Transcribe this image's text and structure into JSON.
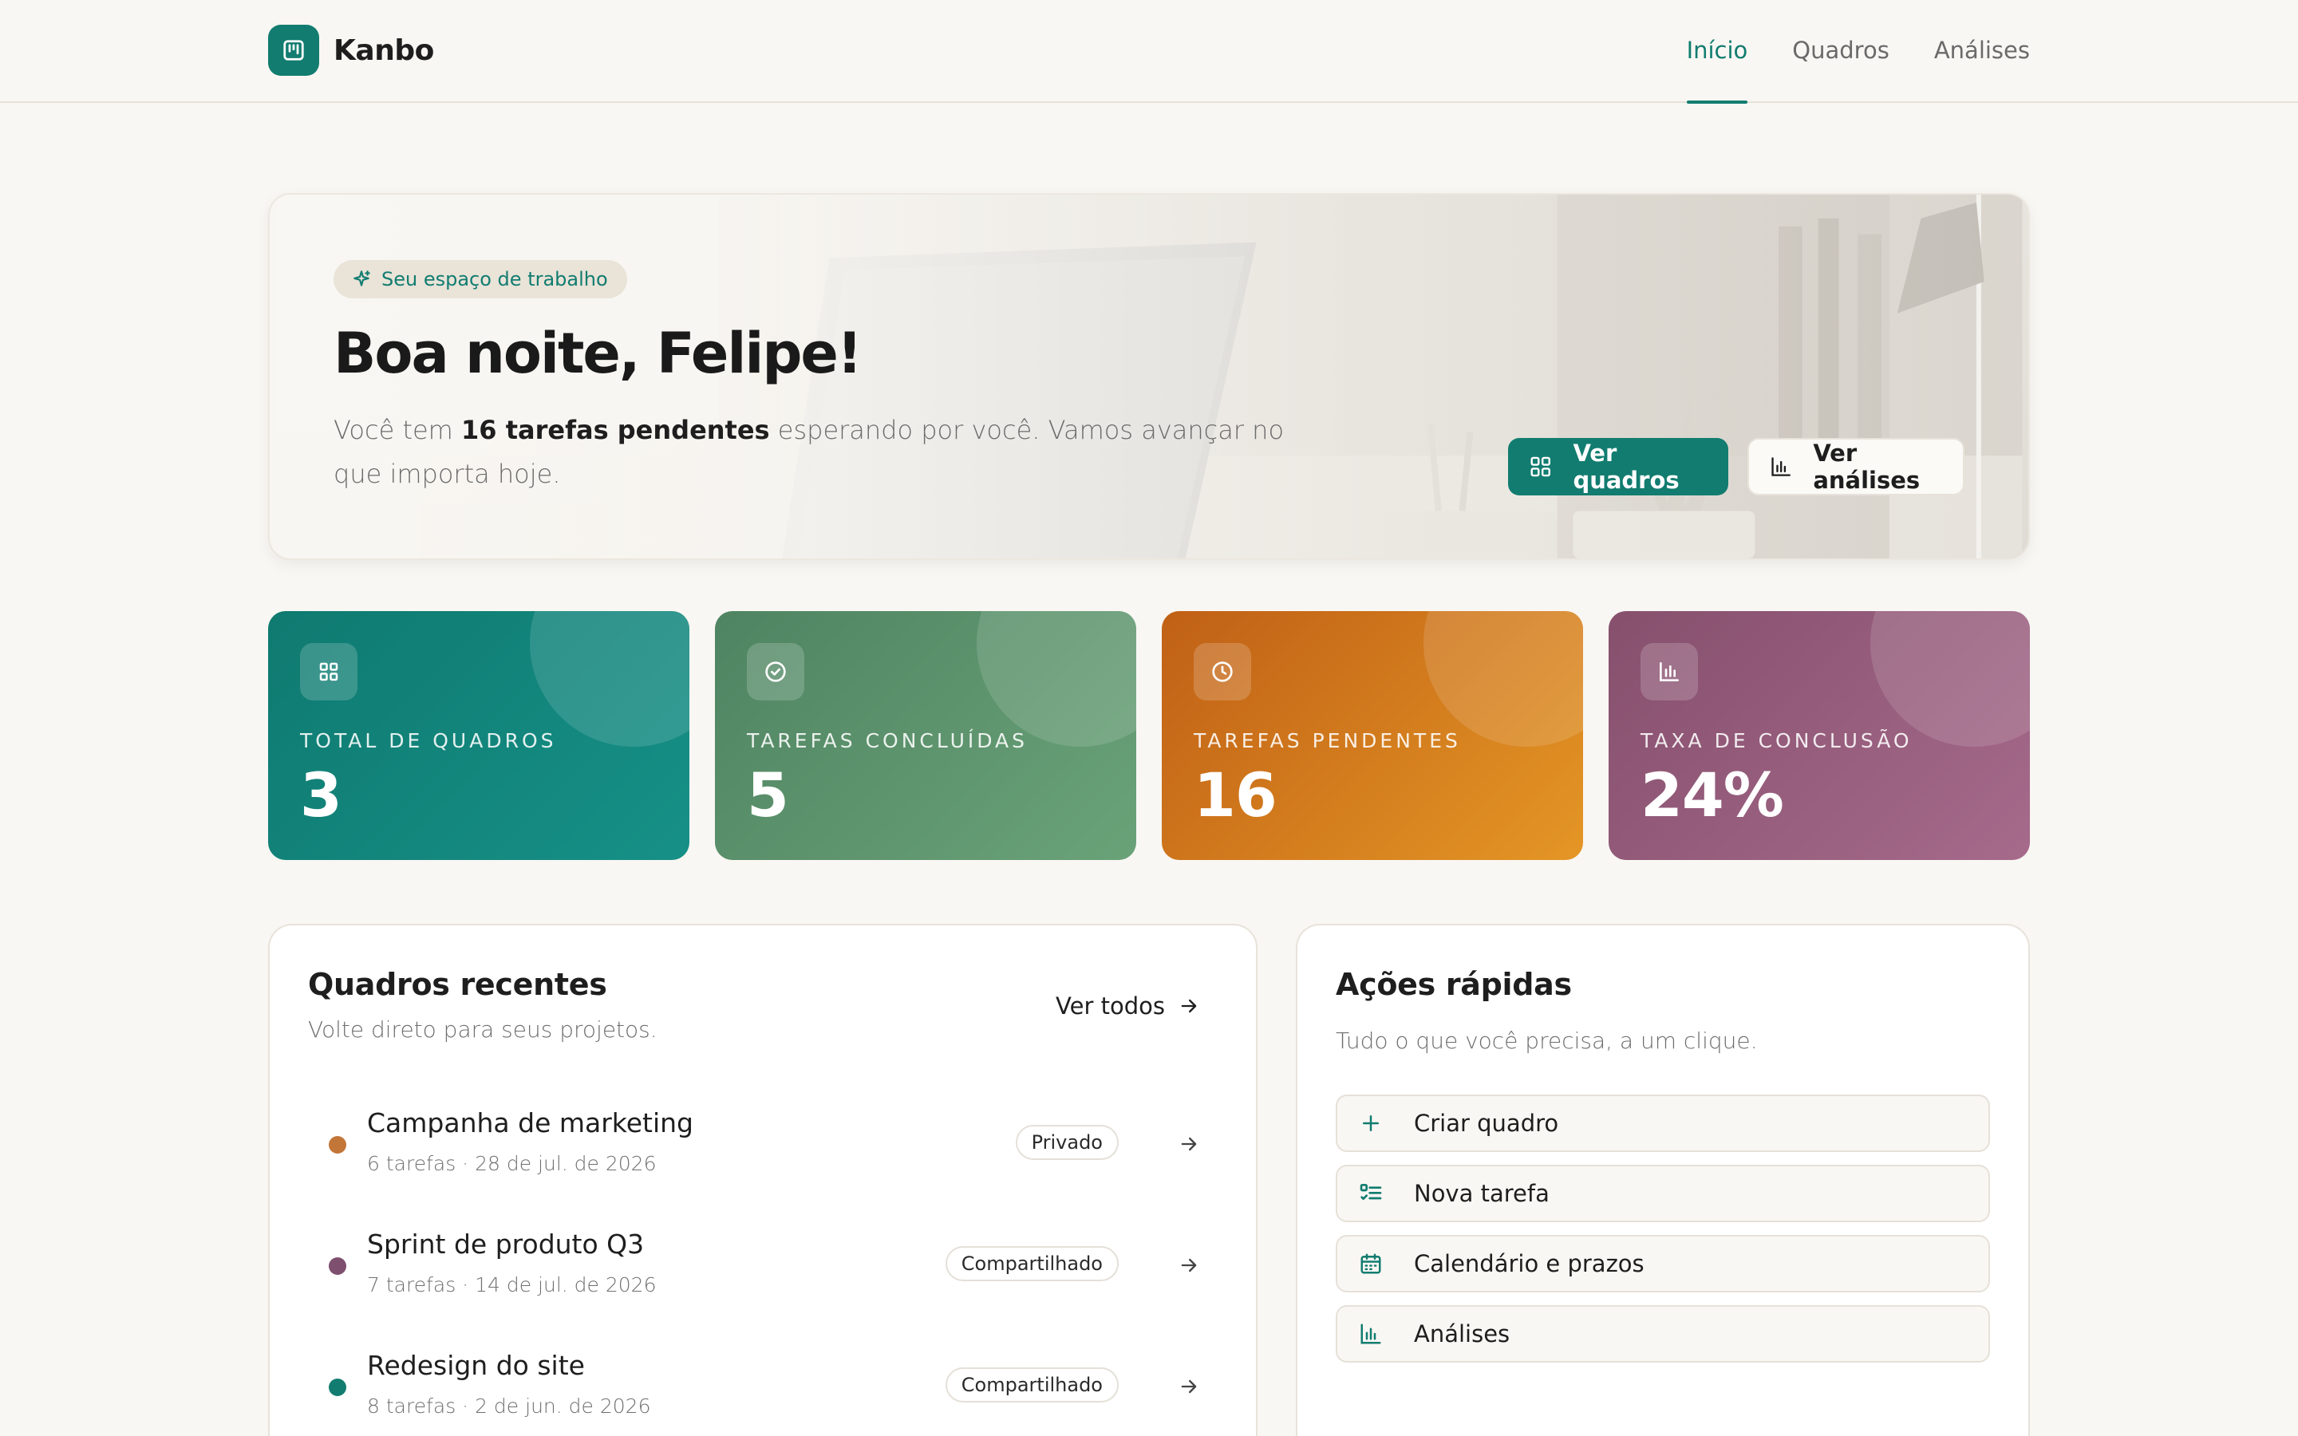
{
  "app": {
    "name": "Kanbo"
  },
  "nav": [
    {
      "label": "Início",
      "active": true
    },
    {
      "label": "Quadros",
      "active": false
    },
    {
      "label": "Análises",
      "active": false
    }
  ],
  "hero": {
    "badge": "Seu espaço de trabalho",
    "title": "Boa noite, Felipe!",
    "subtitle_prefix": "Você tem ",
    "subtitle_bold": "16 tarefas pendentes",
    "subtitle_suffix": " esperando por você. Vamos avançar no que importa hoje.",
    "primary_button": "Ver quadros",
    "secondary_button": "Ver análises"
  },
  "stats": [
    {
      "label": "TOTAL DE QUADROS",
      "value": "3",
      "icon": "grid-icon"
    },
    {
      "label": "TAREFAS CONCLUÍDAS",
      "value": "5",
      "icon": "check-circle-icon"
    },
    {
      "label": "TAREFAS PENDENTES",
      "value": "16",
      "icon": "clock-icon"
    },
    {
      "label": "TAXA DE CONCLUSÃO",
      "value": "24%",
      "icon": "bar-chart-icon"
    }
  ],
  "recent": {
    "title": "Quadros recentes",
    "subtitle": "Volte direto para seus projetos.",
    "see_all": "Ver todos",
    "boards": [
      {
        "name": "Campanha de marketing",
        "meta": "6 tarefas · 28 de jul. de 2026",
        "visibility": "Privado",
        "color": "#c27638"
      },
      {
        "name": "Sprint de produto Q3",
        "meta": "7 tarefas · 14 de jul. de 2026",
        "visibility": "Compartilhado",
        "color": "#7e4f6e"
      },
      {
        "name": "Redesign do site",
        "meta": "8 tarefas · 2 de jun. de 2026",
        "visibility": "Compartilhado",
        "color": "#127c70"
      }
    ]
  },
  "quick": {
    "title": "Ações rápidas",
    "subtitle": "Tudo o que você precisa, a um clique.",
    "actions": [
      {
        "label": "Criar quadro",
        "icon": "plus-icon"
      },
      {
        "label": "Nova tarefa",
        "icon": "checklist-icon"
      },
      {
        "label": "Calendário e prazos",
        "icon": "calendar-icon"
      },
      {
        "label": "Análises",
        "icon": "bar-chart-icon"
      }
    ]
  },
  "colors": {
    "accent": "#127c70",
    "background": "#f9f7f3"
  }
}
